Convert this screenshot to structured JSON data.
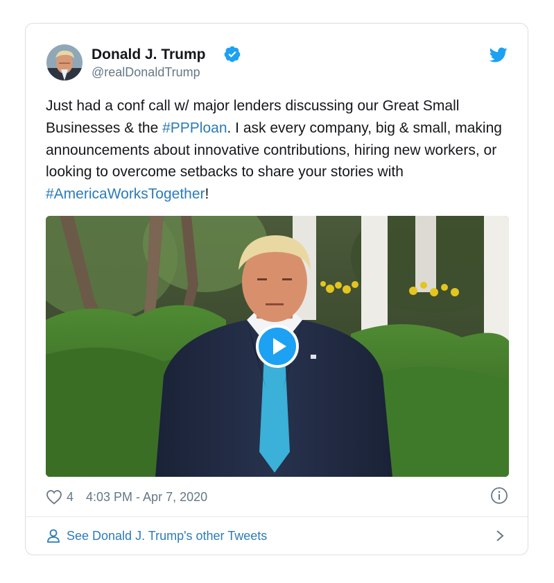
{
  "tweet": {
    "author_name": "Donald J. Trump",
    "author_handle": "@realDonaldTrump",
    "text_part1": "Just had a conf call w/ major lenders discussing our Great Small Businesses & the ",
    "hashtag1": "#PPPloan",
    "text_part2": ". I ask every company, big & small, making announcements about innovative contributions, hiring new workers, or looking to overcome setbacks to share your stories with ",
    "hashtag2": "#AmericaWorksTogether",
    "text_part3": "!",
    "like_count": "4",
    "timestamp": "4:03 PM - Apr 7, 2020",
    "see_more_label": "See Donald J. Trump's other Tweets"
  },
  "colors": {
    "link": "#2b7bb9",
    "twitter_blue": "#1da1f2",
    "text_primary": "#14171a",
    "text_secondary": "#657786",
    "border": "#d9dee3"
  },
  "icons": {
    "verified": "verified-badge-icon",
    "bird": "twitter-bird-icon",
    "play": "play-icon",
    "like": "heart-icon",
    "info": "info-icon",
    "person": "person-icon",
    "chevron": "chevron-right-icon"
  },
  "media": {
    "type": "video",
    "description_visible": false
  }
}
